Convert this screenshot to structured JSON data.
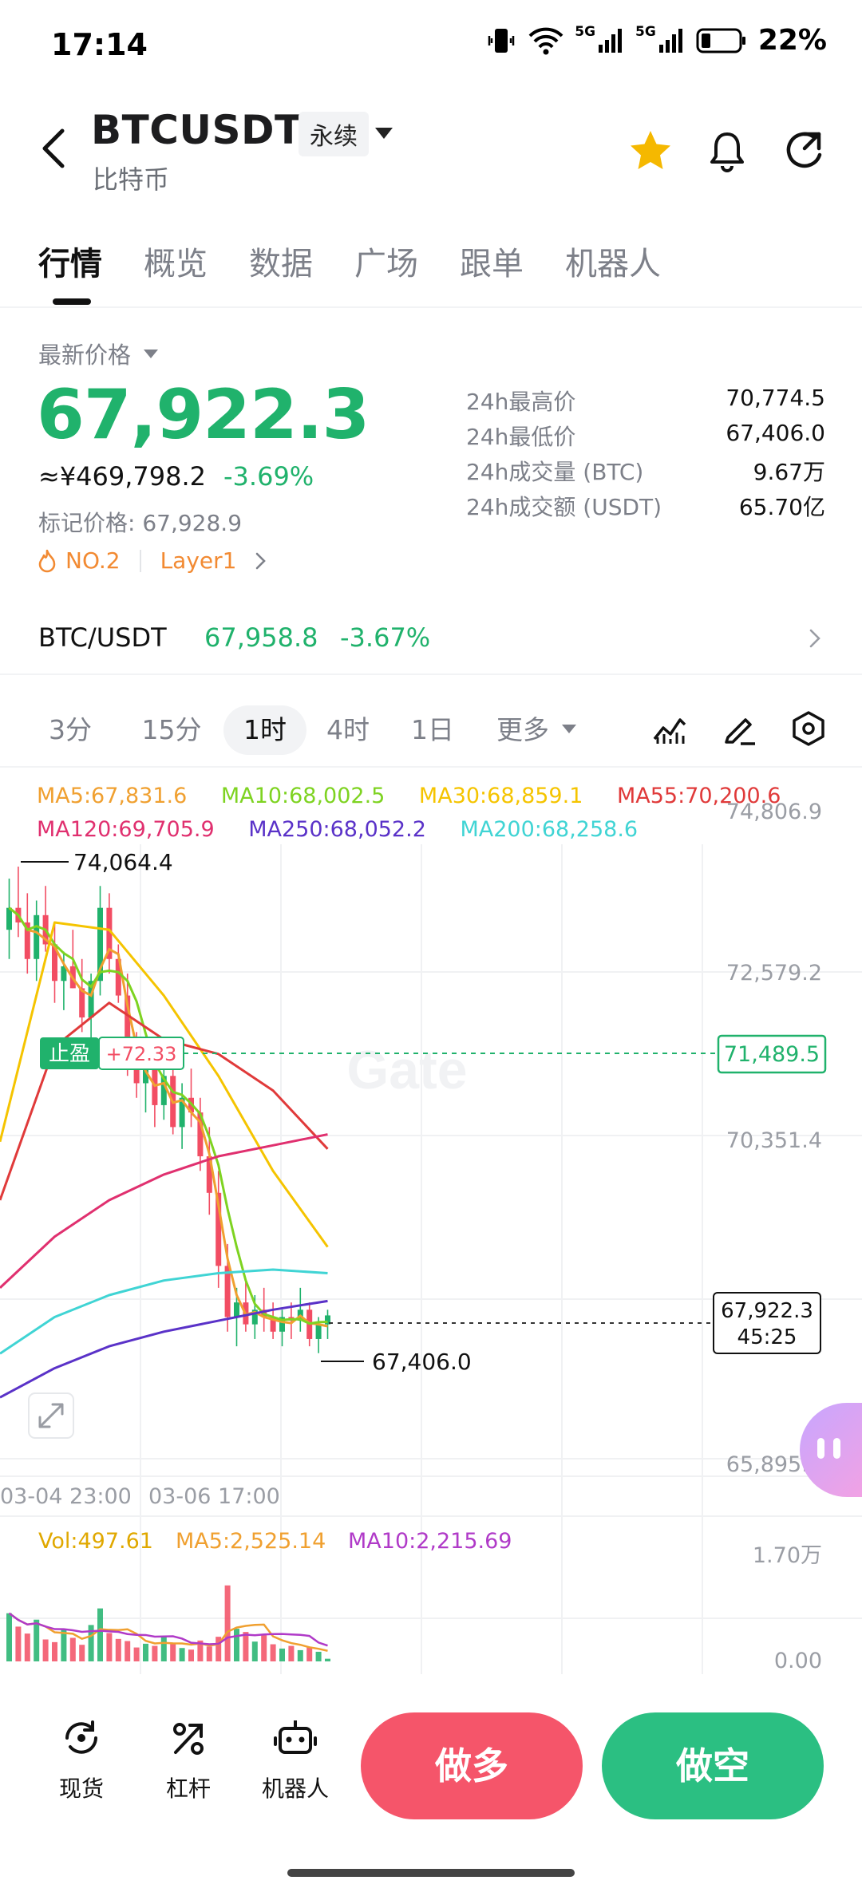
{
  "status_bar": {
    "time": "17:14",
    "battery": "22%",
    "signal_label": "5G"
  },
  "header": {
    "pair": "BTCUSDT",
    "contract_type": "永续",
    "name": "比特币"
  },
  "tabs": [
    "行情",
    "概览",
    "数据",
    "广场",
    "跟单",
    "机器人"
  ],
  "ticker": {
    "last_label": "最新价格",
    "last_price": "67,922.3",
    "cny_price": "≈¥469,798.2",
    "change_pct": "-3.69%",
    "mark_price": "标记价格: 67,928.9",
    "rank": "NO.2",
    "tag": "Layer1",
    "stats": [
      {
        "label": "24h最高价",
        "value": "70,774.5"
      },
      {
        "label": "24h最低价",
        "value": "67,406.0"
      },
      {
        "label": "24h成交量 (BTC)",
        "value": "9.67万"
      },
      {
        "label": "24h成交额 (USDT)",
        "value": "65.70亿"
      }
    ]
  },
  "spot": {
    "name": "BTC/USDT",
    "price": "67,958.8",
    "change": "-3.67%"
  },
  "intervals": {
    "items": [
      "3分",
      "15分",
      "1时",
      "4时",
      "1日",
      "更多"
    ],
    "active": "1时"
  },
  "chart_data": {
    "type": "candlestick",
    "ma_indicators": [
      {
        "label": "MA5:67,831.6",
        "color": "#f0a030"
      },
      {
        "label": "MA10:68,002.5",
        "color": "#7ed321"
      },
      {
        "label": "MA30:68,859.1",
        "color": "#f5c400"
      },
      {
        "label": "MA55:70,200.6",
        "color": "#e03a3a"
      },
      {
        "label": "MA120:69,705.9",
        "color": "#e0306f"
      },
      {
        "label": "MA250:68,052.2",
        "color": "#5a32c8"
      },
      {
        "label": "MA200:68,258.6",
        "color": "#40d4d4"
      }
    ],
    "y_axis_ticks": [
      "74,806.9",
      "72,579.2",
      "70,351.4",
      "65,895.9"
    ],
    "ylim": [
      65895.9,
      74806.9
    ],
    "x_axis_ticks": [
      "03-04 23:00",
      "03-06 17:00"
    ],
    "high_marker": "74,064.4",
    "low_marker": "67,406.0",
    "take_profit": {
      "label": "止盈",
      "pnl": "+72.33",
      "price": "71,489.5"
    },
    "current_price": "67,922.3",
    "countdown": "45:25",
    "watermark": "Gate",
    "candles": [
      [
        73200,
        73900,
        72800,
        73500
      ],
      [
        73500,
        74064.4,
        73100,
        73300
      ],
      [
        73300,
        73700,
        72600,
        72800
      ],
      [
        72800,
        73600,
        72500,
        73400
      ],
      [
        73400,
        73800,
        72900,
        73000
      ],
      [
        73000,
        73300,
        72200,
        72500
      ],
      [
        72500,
        72900,
        72100,
        72700
      ],
      [
        72700,
        73200,
        72400,
        72400
      ],
      [
        72400,
        72800,
        71800,
        72000
      ],
      [
        72000,
        72600,
        71700,
        72500
      ],
      [
        72500,
        73800,
        72300,
        73500
      ],
      [
        73500,
        73700,
        72600,
        72800
      ],
      [
        72800,
        73000,
        72200,
        72300
      ],
      [
        72300,
        72600,
        71200,
        71400
      ],
      [
        71400,
        71800,
        70900,
        71100
      ],
      [
        71100,
        71600,
        70700,
        71300
      ],
      [
        71300,
        71500,
        70500,
        70800
      ],
      [
        70800,
        71400,
        70600,
        71200
      ],
      [
        71200,
        71400,
        70400,
        70500
      ],
      [
        70500,
        71100,
        70200,
        70900
      ],
      [
        70900,
        71300,
        70500,
        70700
      ],
      [
        70700,
        70900,
        69900,
        70100
      ],
      [
        70100,
        70500,
        69300,
        69600
      ],
      [
        69600,
        69900,
        68300,
        68600
      ],
      [
        68600,
        68900,
        67700,
        67900
      ],
      [
        67900,
        68300,
        67500,
        68100
      ],
      [
        68100,
        68400,
        67700,
        67800
      ],
      [
        67800,
        68200,
        67600,
        68000
      ],
      [
        68000,
        68300,
        67700,
        67900
      ],
      [
        67900,
        68100,
        67600,
        67700
      ],
      [
        67700,
        68000,
        67500,
        67900
      ],
      [
        67900,
        68100,
        67600,
        67850
      ],
      [
        67850,
        68300,
        67700,
        68000
      ],
      [
        68000,
        68100,
        67500,
        67600
      ],
      [
        67600,
        67900,
        67406.0,
        67800
      ],
      [
        67800,
        68000,
        67600,
        67922.3
      ]
    ],
    "volume": {
      "vol_label": "Vol:497.61",
      "ma5_label": "MA5:2,525.14",
      "ma10_label": "MA10:2,215.69",
      "y_axis_ticks": [
        "1.70万",
        "0.00"
      ],
      "ylim": [
        0,
        17000
      ],
      "values": [
        9000,
        6500,
        5200,
        7800,
        4100,
        3600,
        5900,
        4400,
        3100,
        6800,
        9900,
        5300,
        4200,
        3800,
        2600,
        3300,
        2900,
        4700,
        3400,
        2500,
        2200,
        3900,
        2800,
        4600,
        14200,
        6100,
        5500,
        3700,
        4900,
        3200,
        2400,
        2900,
        2100,
        2600,
        1800,
        497.61
      ]
    }
  },
  "bottom_nav": [
    {
      "label": "现货",
      "icon": "spot-icon"
    },
    {
      "label": "杠杆",
      "icon": "leverage-icon"
    },
    {
      "label": "机器人",
      "icon": "robot-icon"
    }
  ],
  "actions": {
    "long": "做多",
    "short": "做空"
  },
  "colors": {
    "up": "#20b26c",
    "down": "#f24d63",
    "long_btn": "#f5556a",
    "short_btn": "#2bbf82"
  }
}
